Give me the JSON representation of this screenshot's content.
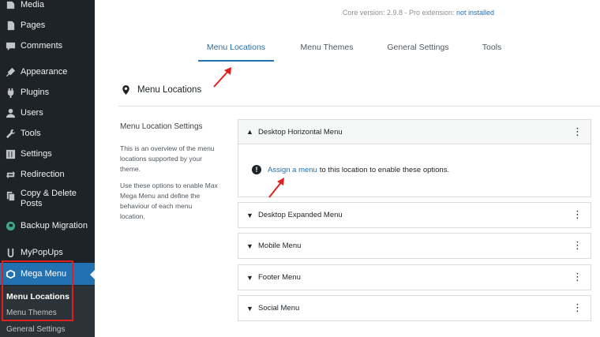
{
  "sidebar": {
    "items": [
      {
        "label": "Media",
        "icon": "media-icon"
      },
      {
        "label": "Pages",
        "icon": "pages-icon"
      },
      {
        "label": "Comments",
        "icon": "comments-icon"
      },
      {
        "label": "Appearance",
        "icon": "appearance-icon"
      },
      {
        "label": "Plugins",
        "icon": "plugins-icon"
      },
      {
        "label": "Users",
        "icon": "users-icon"
      },
      {
        "label": "Tools",
        "icon": "tools-icon"
      },
      {
        "label": "Settings",
        "icon": "settings-icon"
      },
      {
        "label": "Redirection",
        "icon": "redirection-icon"
      },
      {
        "label": "Copy & Delete Posts",
        "icon": "copy-delete-icon"
      },
      {
        "label": "Backup Migration",
        "icon": "backup-icon"
      },
      {
        "label": "MyPopUps",
        "icon": "mypopups-icon"
      },
      {
        "label": "Mega Menu",
        "icon": "mega-menu-icon"
      }
    ],
    "submenu": [
      "Menu Locations",
      "Menu Themes",
      "General Settings"
    ]
  },
  "header": {
    "version_text": "Core version: 2.9.8 - Pro extension:",
    "version_link": "not installed"
  },
  "tabs": [
    "Menu Locations",
    "Menu Themes",
    "General Settings",
    "Tools"
  ],
  "section": {
    "title": "Menu Locations",
    "left_heading": "Menu Location Settings",
    "desc1": "This is an overview of the menu locations supported by your theme.",
    "desc2": "Use these options to enable Max Mega Menu and define the behaviour of each menu location."
  },
  "panels": [
    {
      "title": "Desktop Horizontal Menu"
    },
    {
      "title": "Desktop Expanded Menu"
    },
    {
      "title": "Mobile Menu"
    },
    {
      "title": "Footer Menu"
    },
    {
      "title": "Social Menu"
    }
  ],
  "notice": {
    "link": "Assign a menu",
    "text": "to this location to enable these options."
  },
  "colors": {
    "accent": "#2271b1",
    "sidebar_bg": "#1d2327",
    "annotation_red": "#e0201c"
  }
}
